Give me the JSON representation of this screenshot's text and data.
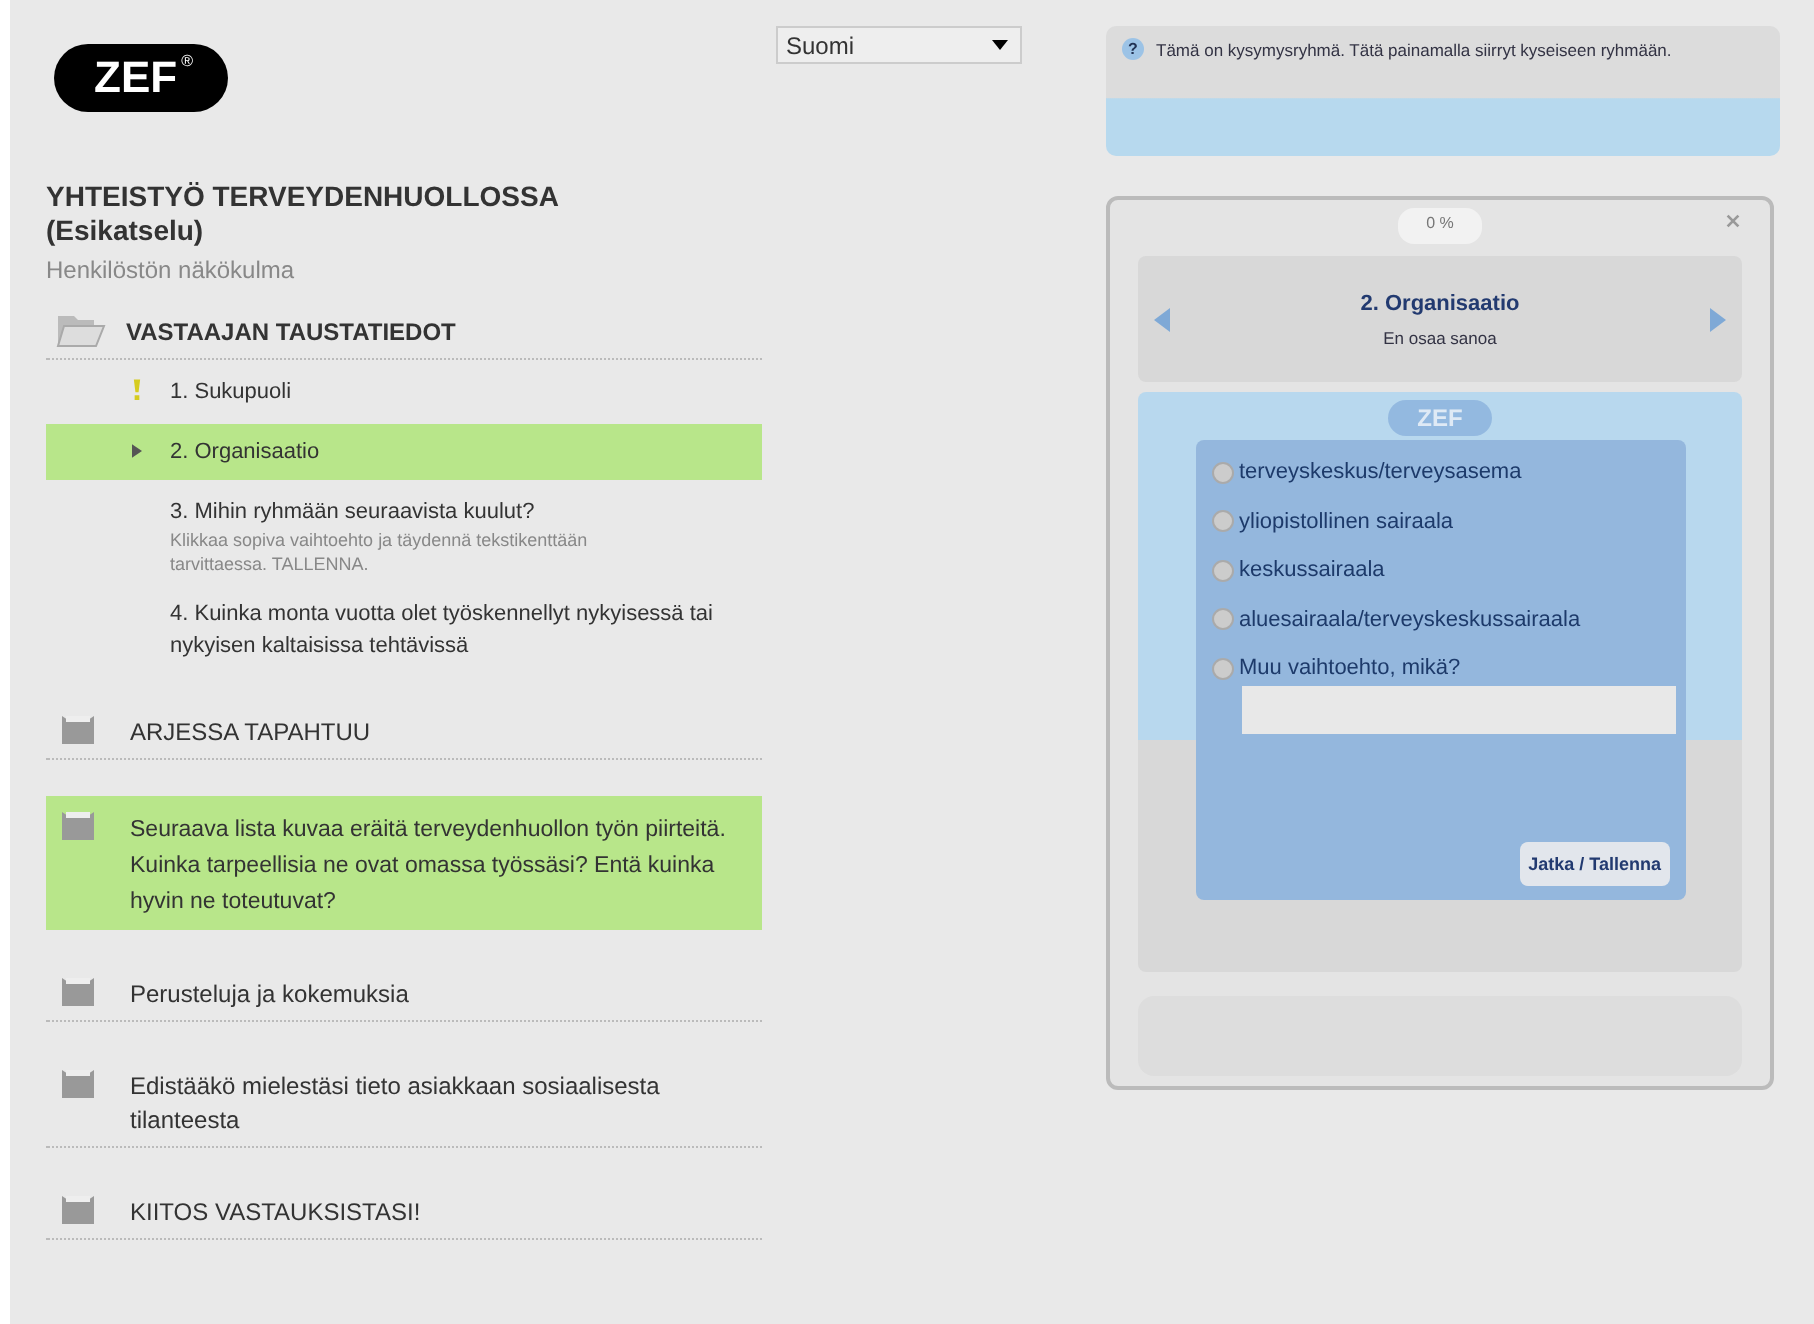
{
  "logo": {
    "text": "ZEF",
    "mark": "®"
  },
  "language": {
    "value": "Suomi"
  },
  "survey": {
    "title": "YHTEISTYÖ TERVEYDENHUOLLOSSA",
    "subtitle": "(Esikatselu)",
    "description": "Henkilöstön näkökulma"
  },
  "sections": [
    {
      "title": "VASTAAJAN TAUSTATIEDOT",
      "expanded": true,
      "selected": false,
      "questions": [
        {
          "label": "1. Sukupuoli",
          "warning": true,
          "selected": false
        },
        {
          "label": "2. Organisaatio",
          "warning": false,
          "selected": true
        },
        {
          "label": "3. Mihin ryhmään seuraavista kuulut?",
          "hint": "Klikkaa sopiva vaihtoehto ja täydennä tekstikenttään tarvittaessa. TALLENNA.",
          "warning": false,
          "selected": false
        },
        {
          "label": "4. Kuinka monta vuotta olet työskennellyt nykyisessä tai nykyisen kaltaisissa tehtävissä",
          "warning": false,
          "selected": false
        }
      ]
    },
    {
      "title": "ARJESSA TAPAHTUU",
      "expanded": false,
      "selected": false
    },
    {
      "title": "Seuraava lista kuvaa eräitä terveydenhuollon työn piirteitä. Kuinka tarpeellisia ne ovat omassa työssäsi? Entä kuinka hyvin ne toteutuvat?",
      "expanded": false,
      "selected": true
    },
    {
      "title": "Perusteluja ja kokemuksia",
      "expanded": false,
      "selected": false
    },
    {
      "title": "Edistääkö mielestäsi tieto asiakkaan sosiaalisesta tilanteesta",
      "expanded": false,
      "selected": false
    },
    {
      "title": "KIITOS VASTAUKSISTASI!",
      "expanded": false,
      "selected": false
    }
  ],
  "help": {
    "icon": "?",
    "text": "Tämä on kysymysryhmä. Tätä painamalla siirryt kyseiseen ryhmään."
  },
  "panel": {
    "progress": "0 %",
    "question": "2. Organisaatio",
    "answer": "En osaa sanoa",
    "logo": "ZEF",
    "options": [
      {
        "label": "terveyskeskus/terveysasema",
        "selected": false
      },
      {
        "label": "yliopistollinen sairaala",
        "selected": false
      },
      {
        "label": "keskussairaala",
        "selected": false
      },
      {
        "label": "aluesairaala/terveyskeskussairaala",
        "selected": false
      },
      {
        "label": "Muu vaihtoehto, mikä?",
        "selected": false,
        "kind": "other"
      }
    ],
    "button": "Jatka / Tallenna"
  }
}
